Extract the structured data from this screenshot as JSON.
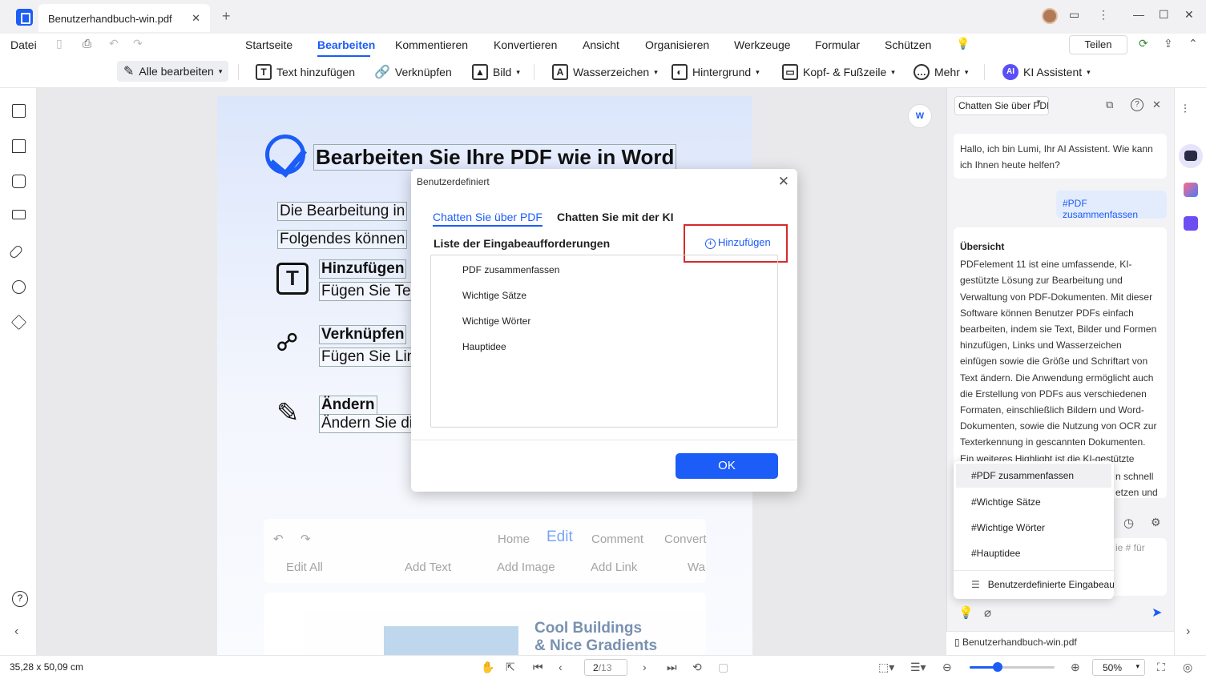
{
  "titlebar": {
    "tab_title": "Benutzerhandbuch-win.pdf"
  },
  "menu": {
    "datei": "Datei",
    "items": [
      "Startseite",
      "Bearbeiten",
      "Kommentieren",
      "Konvertieren",
      "Ansicht",
      "Organisieren",
      "Werkzeuge",
      "Formular",
      "Schützen"
    ],
    "active": "Bearbeiten",
    "share": "Teilen"
  },
  "toolbar": {
    "edit_all": "Alle bearbeiten",
    "add_text": "Text hinzufügen",
    "link": "Verknüpfen",
    "image": "Bild",
    "watermark": "Wasserzeichen",
    "background": "Hintergrund",
    "header_footer": "Kopf- & Fußzeile",
    "more": "Mehr",
    "ai": "KI Assistent"
  },
  "page": {
    "title": "Bearbeiten Sie Ihre PDF wie in Word",
    "line1": "Die Bearbeitung in",
    "line2": "Folgendes können",
    "h1": "Hinzufügen",
    "t1": "Fügen Sie Text",
    "h2": "Verknüpfen",
    "t2": "Fügen Sie Link",
    "h3": "Ändern",
    "t3": "Ändern Sie die",
    "mock": {
      "home": "Home",
      "edit": "Edit",
      "comment": "Comment",
      "convert": "Convert",
      "edit_all": "Edit All",
      "add_text": "Add Text",
      "add_image": "Add Image",
      "add_link": "Add Link",
      "wa": "Wa"
    },
    "cool1": "Cool Buildings",
    "cool2": "& Nice Gradients"
  },
  "dialog": {
    "title": "Benutzerdefiniert",
    "tab_active": "Chatten Sie über PDF",
    "tab_other": "Chatten Sie mit der KI",
    "list_label": "Liste der Eingabeaufforderungen",
    "add": "Hinzufügen",
    "items": [
      "PDF zusammenfassen",
      "Wichtige Sätze",
      "Wichtige Wörter",
      "Hauptidee"
    ],
    "ok": "OK"
  },
  "ai_panel": {
    "select": "Chatten Sie über PDF",
    "greeting": "Hallo, ich bin Lumi, Ihr AI Assistent. Wie kann ich Ihnen heute helfen?",
    "user_msg": "#PDF zusammenfassen",
    "overview_title": "Übersicht",
    "overview_text": "PDFelement 11 ist eine umfassende, KI-gestützte Lösung zur Bearbeitung und Verwaltung von PDF-Dokumenten. Mit dieser Software können Benutzer PDFs einfach bearbeiten, indem sie Text, Bilder und Formen hinzufügen, Links und Wasserzeichen einfügen sowie die Größe und Schriftart von Text ändern. Die Anwendung ermöglicht auch die Erstellung von PDFs aus verschiedenen Formaten, einschließlich Bildern und Word-Dokumenten, sowie die Nutzung von OCR zur Texterkennung in gescannten Dokumenten. Ein weiteres Highlight ist die KI-gestützte Unterstützung, die",
    "partial1": "n schnell",
    "partial2": "etzen und",
    "input_partial": "ie # für",
    "popup": [
      "#PDF zusammenfassen",
      "#Wichtige Sätze",
      "#Wichtige Wörter",
      "#Hauptidee"
    ],
    "popup_custom": "Benutzerdefinierte Eingabeau",
    "file": "Benutzerhandbuch-win.pdf"
  },
  "status": {
    "dimensions": "35,28 x 50,09 cm",
    "page": "2",
    "pages": "/13",
    "zoom": "50%",
    "zoom_level": 0.33
  }
}
